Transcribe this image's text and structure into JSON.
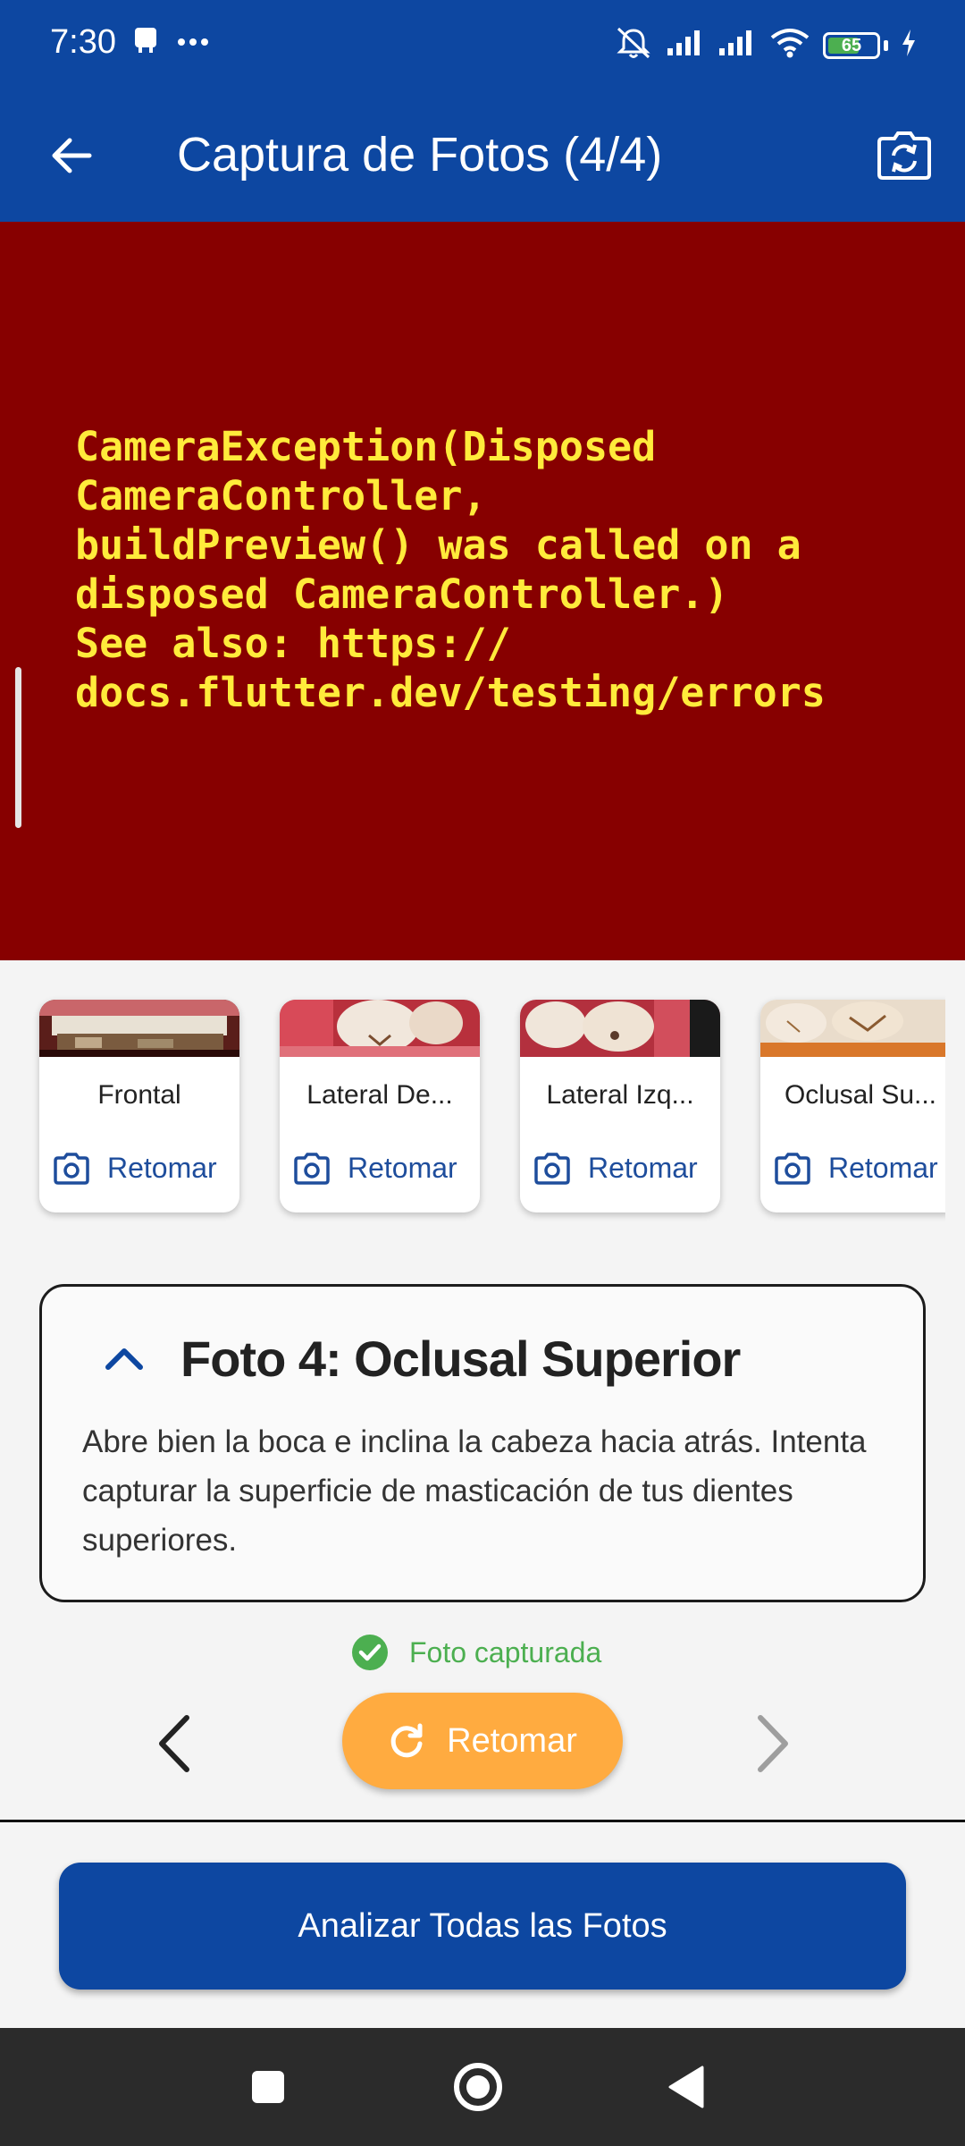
{
  "status_bar": {
    "time": "7:30",
    "battery_level": "65",
    "battery_fraction": 0.65
  },
  "app_bar": {
    "title": "Captura de Fotos (4/4)"
  },
  "camera_error": {
    "message": "CameraException(Disposed\nCameraController,\nbuildPreview() was called on a\ndisposed CameraController.)\nSee also: https://\ndocs.flutter.dev/testing/errors"
  },
  "thumbnails": [
    {
      "label": "Frontal",
      "action": "Retomar"
    },
    {
      "label": "Lateral De...",
      "action": "Retomar"
    },
    {
      "label": "Lateral Izq...",
      "action": "Retomar"
    },
    {
      "label": "Oclusal Su...",
      "action": "Retomar"
    }
  ],
  "instructions": {
    "title": "Foto 4: Oclusal Superior",
    "body": "Abre bien la boca e inclina la cabeza hacia atrás. Intenta capturar la superficie de masticación de tus dientes superiores."
  },
  "capture_status": "Foto capturada",
  "controls": {
    "retake_label": "Retomar"
  },
  "analyze_button": "Analizar Todas las Fotos",
  "colors": {
    "primary": "#0d47a1",
    "error_bg": "#870000",
    "error_text": "#ffeb3b",
    "accent": "#ffab40",
    "success": "#4caf50"
  }
}
